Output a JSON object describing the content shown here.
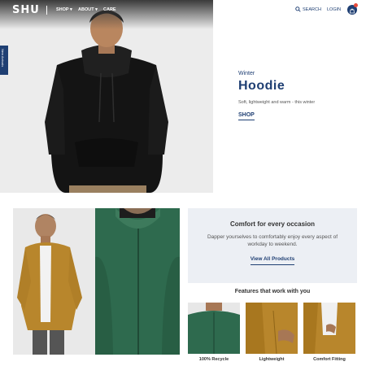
{
  "brand": {
    "logo_text": "SHU"
  },
  "nav": {
    "links": [
      "SHOP ▾",
      "ABOUT ▾",
      "CARE"
    ],
    "search_label": "SEARCH",
    "login_label": "LOGIN"
  },
  "side_tab": {
    "label": "New Arrivals"
  },
  "hero": {
    "kicker": "Winter",
    "title": "Hoodie",
    "subtitle": "Soft, lightweight and warm - this winter",
    "cta": "SHOP"
  },
  "promo": {
    "title": "Comfort for every occasion",
    "text": "Dapper yourselves to comfortably enjoy every aspect of workday to weekend.",
    "cta": "View All Products"
  },
  "features": {
    "title": "Features that work with you",
    "items": [
      {
        "label": "100% Recycle",
        "color": "#2e6a4e"
      },
      {
        "label": "Lightweight",
        "color": "#b8862c"
      },
      {
        "label": "Comfort Fitting",
        "color": "#b8862c"
      }
    ]
  },
  "colors": {
    "brand_navy": "#1f3f73",
    "green_fleece": "#2e6a4e",
    "mustard": "#b8862c"
  }
}
